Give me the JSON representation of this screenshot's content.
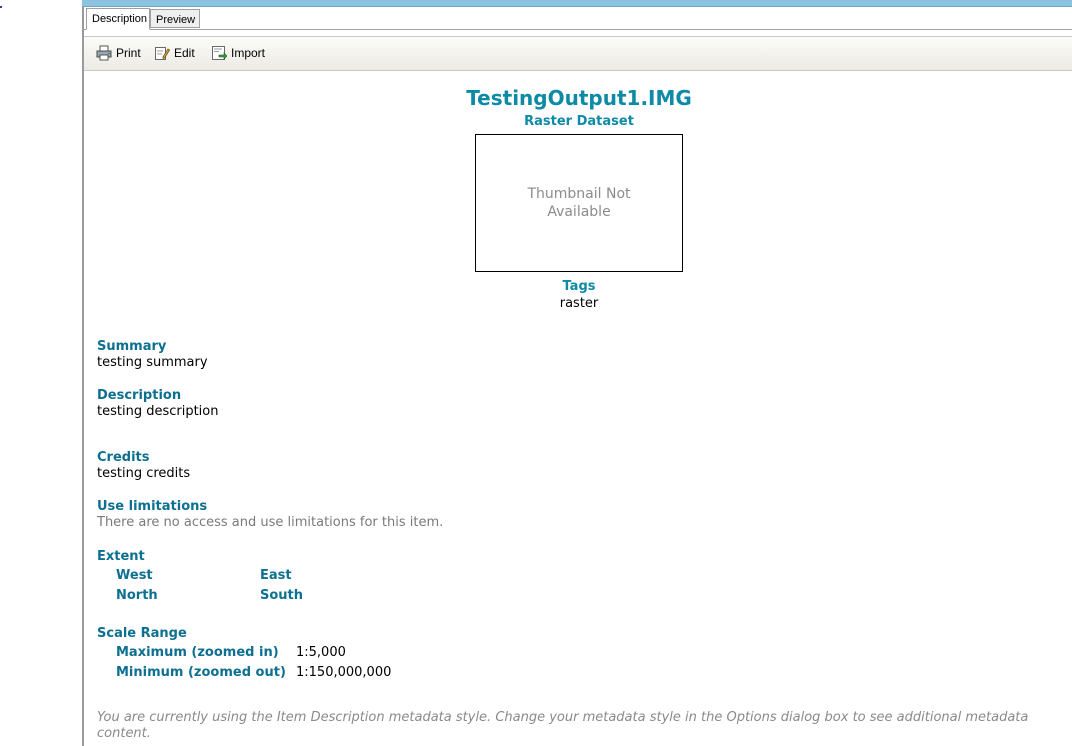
{
  "tabs": [
    "Description",
    "Preview"
  ],
  "toolbar": {
    "print": "Print",
    "edit": "Edit",
    "import": "Import"
  },
  "item": {
    "title": "TestingOutput1.IMG",
    "type": "Raster Dataset",
    "thumbnail_text": "Thumbnail Not Available",
    "tags_label": "Tags",
    "tags_value": "raster"
  },
  "summary": {
    "label": "Summary",
    "text": "testing summary"
  },
  "description": {
    "label": "Description",
    "text": "testing description"
  },
  "credits": {
    "label": "Credits",
    "text": "testing credits"
  },
  "use_limitations": {
    "label": "Use limitations",
    "text": "There are no access and use limitations for this item."
  },
  "extent": {
    "label": "Extent",
    "west": "West",
    "east": "East",
    "north": "North",
    "south": "South"
  },
  "scale_range": {
    "label": "Scale Range",
    "max_label": "Maximum (zoomed in)",
    "max_value": "1:5,000",
    "min_label": "Minimum (zoomed out)",
    "min_value": "1:150,000,000"
  },
  "footer_note": "You are currently using the Item Description metadata style. Change your metadata style in the Options dialog box to see additional metadata content.",
  "colors": {
    "heading": "#0d8aa5",
    "accent_bar": "#8cc3de"
  }
}
